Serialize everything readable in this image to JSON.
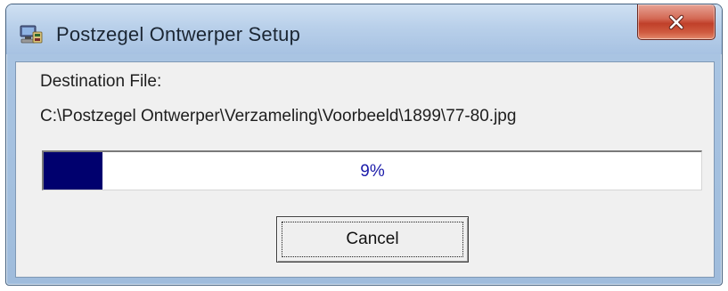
{
  "window": {
    "title": "Postzegel Ontwerper Setup",
    "app_icon": "setup-computer-icon",
    "close_icon": "close-icon"
  },
  "dialog": {
    "destination_label": "Destination File:",
    "destination_path": "C:\\Postzegel Ontwerper\\Verzameling\\Voorbeeld\\1899\\77-80.jpg"
  },
  "progress": {
    "percent": 9,
    "text": "9%",
    "fill_color": "#00006e",
    "text_color": "#1c1caa"
  },
  "buttons": {
    "cancel_label": "Cancel"
  },
  "colors": {
    "close_button": "#c0402a",
    "title_bar": "#b9d0ea",
    "client_bg": "#f0f0f0"
  }
}
